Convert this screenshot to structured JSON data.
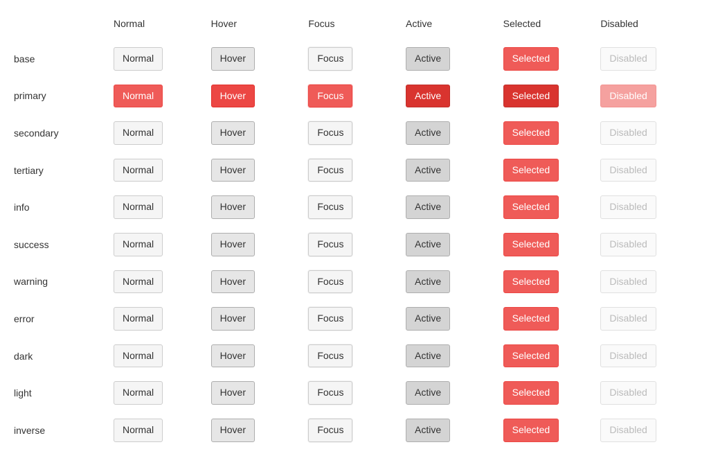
{
  "columns": [
    {
      "key": "normal",
      "label": "Normal",
      "button_label": "Normal"
    },
    {
      "key": "hover",
      "label": "Hover",
      "button_label": "Hover"
    },
    {
      "key": "focus",
      "label": "Focus",
      "button_label": "Focus"
    },
    {
      "key": "active",
      "label": "Active",
      "button_label": "Active"
    },
    {
      "key": "selected",
      "label": "Selected",
      "button_label": "Selected"
    },
    {
      "key": "disabled",
      "label": "Disabled",
      "button_label": "Disabled"
    }
  ],
  "rows": [
    {
      "key": "base",
      "label": "base"
    },
    {
      "key": "primary",
      "label": "primary"
    },
    {
      "key": "secondary",
      "label": "secondary"
    },
    {
      "key": "tertiary",
      "label": "tertiary"
    },
    {
      "key": "info",
      "label": "info"
    },
    {
      "key": "success",
      "label": "success"
    },
    {
      "key": "warning",
      "label": "warning"
    },
    {
      "key": "error",
      "label": "error"
    },
    {
      "key": "dark",
      "label": "dark"
    },
    {
      "key": "light",
      "label": "light"
    },
    {
      "key": "inverse",
      "label": "inverse"
    }
  ],
  "colors": {
    "accent": "#EF5B58"
  }
}
